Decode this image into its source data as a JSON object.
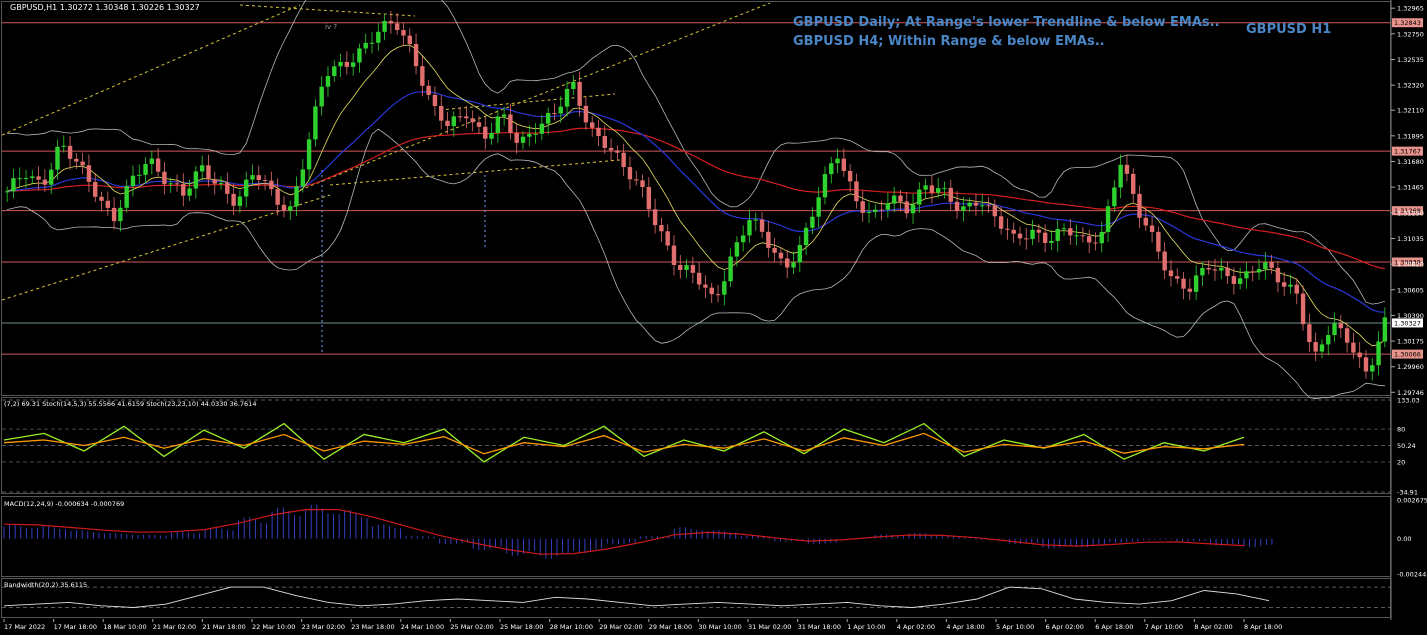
{
  "header": {
    "symbol_label": "GBPUSD,H1  1.30272 1.30348 1.30226 1.30327",
    "annotation_line1": "GBPUSD Daily; At Range's lower Trendline & below EMAs..",
    "annotation_line2": "GBPUSD H4; Within Range & below EMAs..",
    "timeframe_title": "GBPUSD H1",
    "wave_label": "iv ?"
  },
  "colors": {
    "background": "#000000",
    "grid": "#3a3a3a",
    "up_candle": "#2fd12f",
    "down_candle": "#e26f6f",
    "level_line": "#d05a5a",
    "level_label_bg": "#e8938c",
    "trend_line": "#d6c43b",
    "ema_red": "#d42020",
    "ema_blue": "#2a37d6",
    "bands": "#b8b8b8",
    "stoch_green": "#9cf026",
    "stoch_orange": "#ff9a00",
    "stoch_blue": "#2ea0ff",
    "macd_hist": "#3b48d8",
    "macd_signal": "#cc1a1a"
  },
  "chart_data": [
    {
      "type": "candlestick",
      "name": "GBPUSD,H1",
      "price_axis_ticks": [
        "1.32965",
        "1.32750",
        "1.32535",
        "1.32320",
        "1.32110",
        "1.31895",
        "1.31680",
        "1.31465",
        "1.31250",
        "1.31035",
        "1.30820",
        "1.30605",
        "1.30390",
        "1.30175",
        "1.29960",
        "1.29746"
      ],
      "price_range": [
        1.2974,
        1.33
      ],
      "horizontal_levels": [
        "1.32843",
        "1.31767",
        "1.31268",
        "1.30838",
        "1.30327",
        "1.30066"
      ],
      "current_price": "1.30327",
      "time_ticks": [
        "17 Mar 2022",
        "17 Mar 18:00",
        "18 Mar 10:00",
        "21 Mar 02:00",
        "21 Mar 18:00",
        "22 Mar 10:00",
        "23 Mar 02:00",
        "23 Mar 18:00",
        "24 Mar 10:00",
        "25 Mar 02:00",
        "25 Mar 18:00",
        "28 Mar 10:00",
        "29 Mar 02:00",
        "29 Mar 18:00",
        "30 Mar 10:00",
        "31 Mar 02:00",
        "31 Mar 18:00",
        "1 Apr 10:00",
        "4 Apr 02:00",
        "4 Apr 18:00",
        "5 Apr 10:00",
        "6 Apr 02:00",
        "6 Apr 18:00",
        "7 Apr 10:00",
        "8 Apr 02:00",
        "8 Apr 18:00"
      ],
      "close_path": [
        1.314,
        1.316,
        1.315,
        1.318,
        1.3165,
        1.3145,
        1.312,
        1.3148,
        1.317,
        1.3155,
        1.314,
        1.316,
        1.315,
        1.3135,
        1.3158,
        1.314,
        1.3128,
        1.318,
        1.324,
        1.325,
        1.3262,
        1.3275,
        1.3284,
        1.326,
        1.3215,
        1.3195,
        1.321,
        1.319,
        1.3205,
        1.318,
        1.32,
        1.321,
        1.323,
        1.3195,
        1.3185,
        1.316,
        1.314,
        1.311,
        1.308,
        1.307,
        1.305,
        1.309,
        1.312,
        1.31,
        1.308,
        1.31,
        1.314,
        1.3175,
        1.314,
        1.312,
        1.3135,
        1.313,
        1.315,
        1.314,
        1.3125,
        1.314,
        1.312,
        1.31,
        1.311,
        1.3105,
        1.311,
        1.3098,
        1.311,
        1.317,
        1.3125,
        1.31,
        1.307,
        1.306,
        1.308,
        1.3075,
        1.307,
        1.308,
        1.307,
        1.306,
        1.3,
        1.303,
        1.302,
        1.299,
        1.303
      ]
    },
    {
      "type": "line",
      "name": "Stochastics",
      "label": "(7,2) 69.31  Stoch(14,5,3) 55.5566 41.6159  Stoch(23,23,10) 44.0330 36.7614",
      "axis_ticks": [
        "133.03",
        "80",
        "50.24",
        "20",
        "-34.91"
      ],
      "series": [
        {
          "name": "Stoch(14,5,3)",
          "values": [
            60,
            72,
            40,
            85,
            30,
            78,
            45,
            90,
            25,
            70,
            55,
            80,
            20,
            65,
            50,
            85,
            30,
            60,
            40,
            75,
            35,
            80,
            55,
            90,
            30,
            60,
            45,
            70,
            25,
            55,
            40,
            65
          ]
        },
        {
          "name": "Stoch(23,23,10)",
          "values": [
            55,
            60,
            50,
            65,
            45,
            62,
            50,
            70,
            40,
            58,
            52,
            66,
            35,
            55,
            48,
            68,
            38,
            52,
            45,
            62,
            40,
            64,
            50,
            72,
            38,
            52,
            46,
            58,
            36,
            48,
            44,
            52
          ]
        }
      ]
    },
    {
      "type": "bar",
      "name": "MACD",
      "label": "MACD(12,24,9) -0.000634 -0.000769",
      "axis_ticks": [
        "0.002675",
        "0.00",
        "-0.002445"
      ],
      "values": [
        0.001,
        0.0009,
        0.0006,
        0.0004,
        0.0003,
        0.0005,
        0.0008,
        0.0015,
        0.0022,
        0.0024,
        0.002,
        0.001,
        0.0002,
        -0.0004,
        -0.0008,
        -0.0012,
        -0.0014,
        -0.001,
        -0.0004,
        0.0002,
        0.0008,
        0.0006,
        0.0002,
        -0.0002,
        -0.0004,
        0.0,
        0.0003,
        0.0004,
        0.0002,
        -0.0001,
        -0.0004,
        -0.0007,
        -0.0006,
        -0.0003,
        -0.0001,
        -0.0002,
        -0.0005,
        -0.0006
      ]
    },
    {
      "type": "line",
      "name": "Bandwidth",
      "label": "Bandwidth(20,2) 35.6115",
      "values": [
        0.3,
        0.35,
        0.4,
        0.3,
        0.25,
        0.35,
        0.6,
        0.85,
        0.85,
        0.6,
        0.4,
        0.3,
        0.35,
        0.45,
        0.5,
        0.45,
        0.4,
        0.55,
        0.5,
        0.4,
        0.3,
        0.35,
        0.4,
        0.35,
        0.3,
        0.35,
        0.4,
        0.3,
        0.25,
        0.35,
        0.5,
        0.85,
        0.8,
        0.5,
        0.4,
        0.35,
        0.45,
        0.75,
        0.65,
        0.45
      ]
    }
  ]
}
